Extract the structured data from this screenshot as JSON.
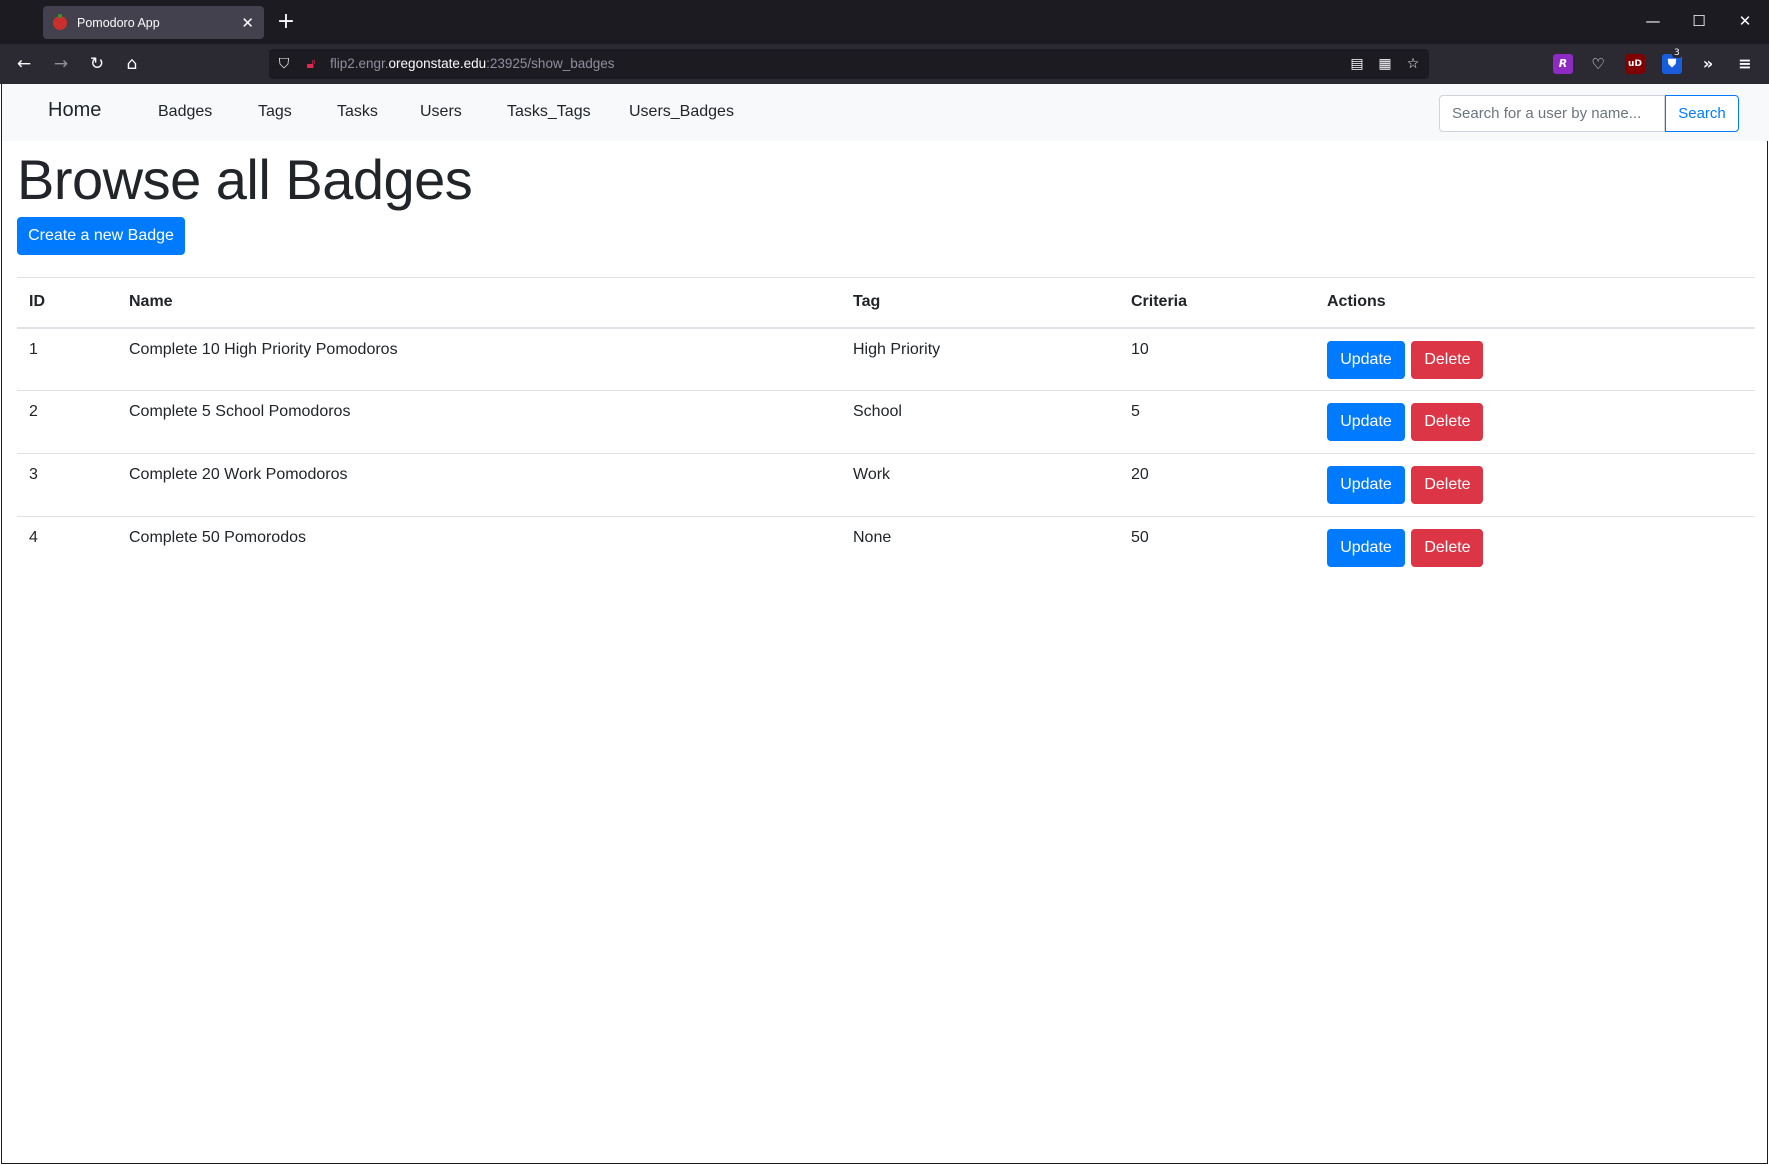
{
  "browser": {
    "tab_title": "Pomodoro App",
    "url_prefix": "flip2.engr.",
    "url_host": "oregonstate.edu",
    "url_suffix": ":23925/show_badges",
    "ext_badge_count": "3"
  },
  "nav": {
    "brand": "Home",
    "links": [
      "Badges",
      "Tags",
      "Tasks",
      "Users",
      "Tasks_Tags",
      "Users_Badges"
    ],
    "search_placeholder": "Search for a user by name...",
    "search_label": "Search"
  },
  "main": {
    "title": "Browse all Badges",
    "create_label": "Create a new Badge",
    "columns": [
      "ID",
      "Name",
      "Tag",
      "Criteria",
      "Actions"
    ],
    "rows": [
      {
        "id": "1",
        "name": "Complete 10 High Priority Pomodoros",
        "tag": "High Priority",
        "criteria": "10"
      },
      {
        "id": "2",
        "name": "Complete 5 School Pomodoros",
        "tag": "School",
        "criteria": "5"
      },
      {
        "id": "3",
        "name": "Complete 20 Work Pomodoros",
        "tag": "Work",
        "criteria": "20"
      },
      {
        "id": "4",
        "name": "Complete 50 Pomorodos",
        "tag": "None",
        "criteria": "50"
      }
    ],
    "update_label": "Update",
    "delete_label": "Delete"
  },
  "colors": {
    "primary": "#007bff",
    "danger": "#dc3545",
    "chrome_dark": "#1c1b22"
  }
}
